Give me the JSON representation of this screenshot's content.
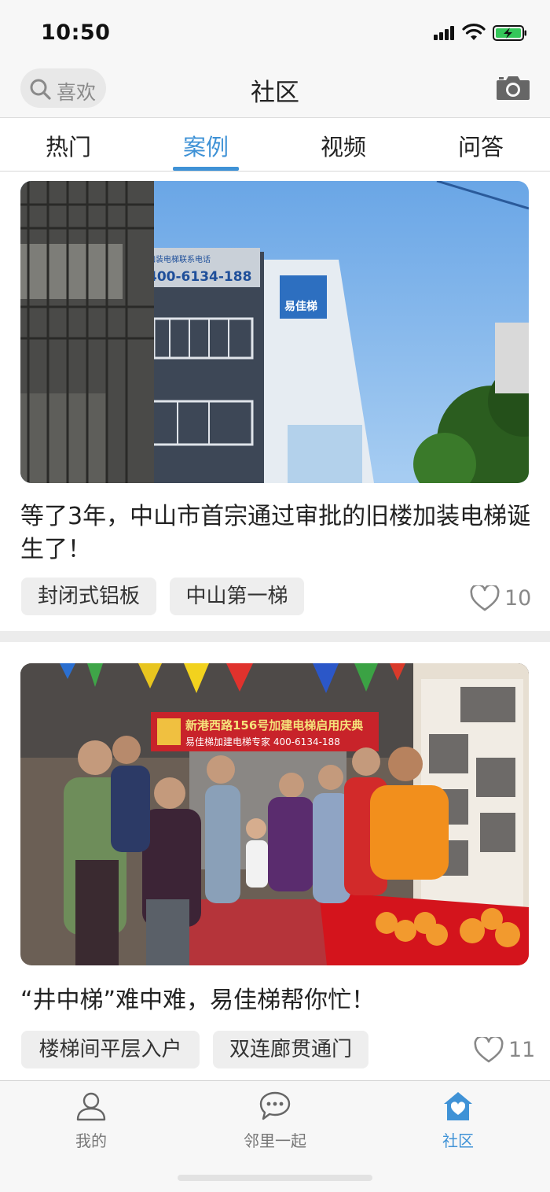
{
  "status_bar": {
    "time": "10:50"
  },
  "header": {
    "search_text": "喜欢",
    "title": "社区"
  },
  "tabs": [
    {
      "label": "热门",
      "active": false
    },
    {
      "label": "案例",
      "active": true
    },
    {
      "label": "视频",
      "active": false
    },
    {
      "label": "问答",
      "active": false
    }
  ],
  "posts": [
    {
      "title": "等了3年，中山市首宗通过审批的旧楼加装电梯诞生了！",
      "image_sign_phone": "400-6134-188",
      "image_brand": "易佳梯",
      "tags": [
        "封闭式铝板",
        "中山第一梯"
      ],
      "likes": "10"
    },
    {
      "title": "“井中梯”难中难，易佳梯帮你忙！",
      "image_banner_line1": "新港西路156号加建电梯启用庆典",
      "image_banner_line2": "易佳梯加建电梯专家 400-6134-188",
      "tags": [
        "楼梯间平层入户",
        "双连廊贯通门"
      ],
      "likes": "11"
    }
  ],
  "tabbar": [
    {
      "label": "我的",
      "icon": "person-icon",
      "active": false
    },
    {
      "label": "邻里一起",
      "icon": "chat-bubble-icon",
      "active": false
    },
    {
      "label": "社区",
      "icon": "home-heart-icon",
      "active": true
    }
  ],
  "colors": {
    "accent": "#3f92d6",
    "tag_bg": "#eeeeee",
    "bar_bg": "#f7f7f7"
  }
}
